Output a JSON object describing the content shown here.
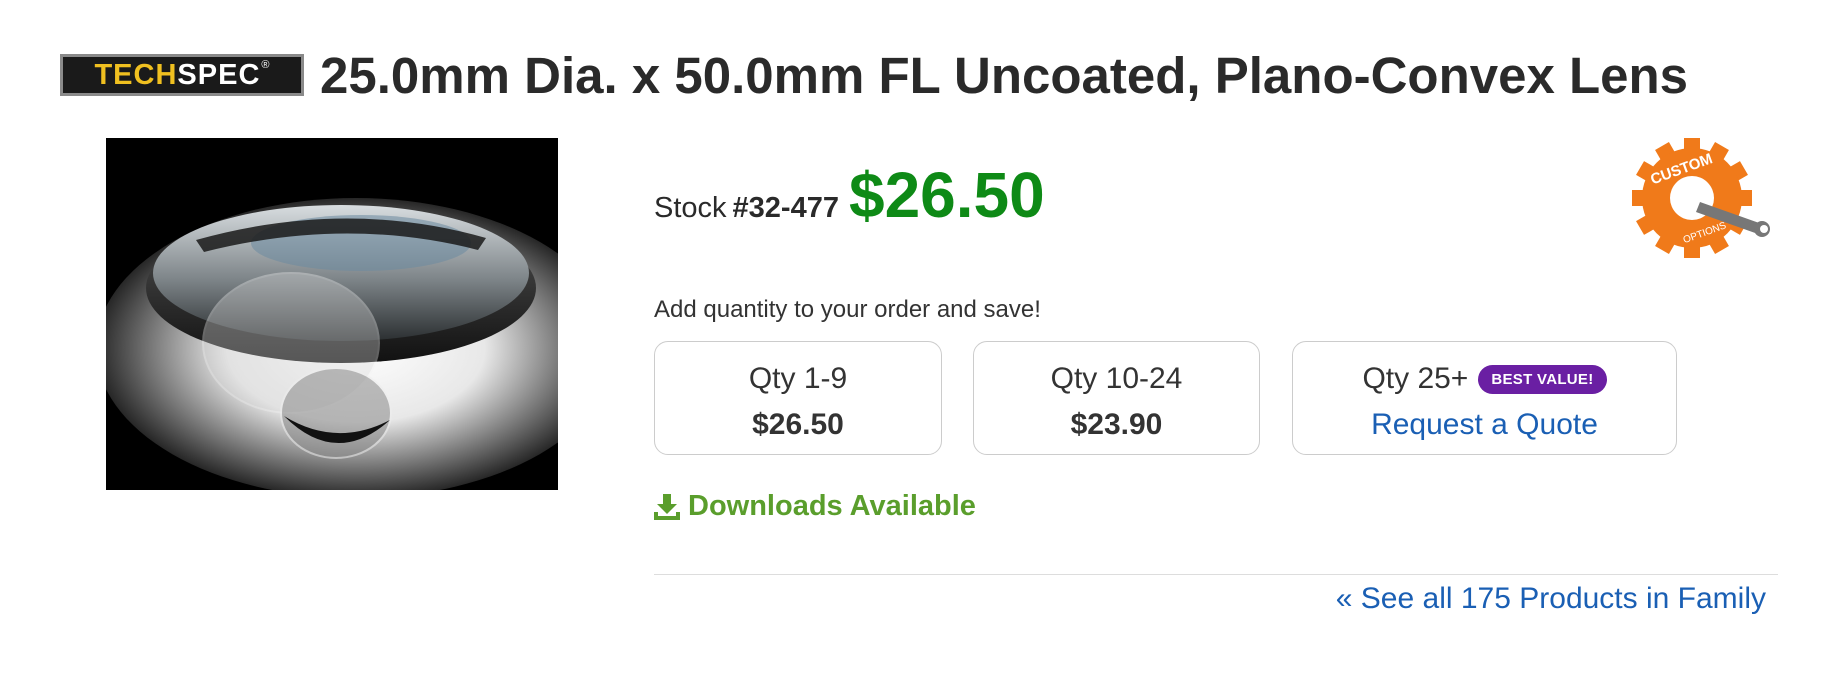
{
  "header": {
    "logo": {
      "word1": "TECH",
      "word2": "SPEC",
      "mark": "®"
    },
    "title": "25.0mm Dia. x 50.0mm FL Uncoated, Plano-Convex Lens"
  },
  "product": {
    "image_icon": "lens-photo",
    "stock_label": "Stock",
    "stock_number": "#32-477",
    "price": "$26.50",
    "price_color": "#0e8a16",
    "custom_badge": {
      "word1": "CUSTOM",
      "word2": "OPTIONS",
      "icon": "wrench-gear-icon",
      "color": "#f07a1a"
    }
  },
  "pricing": {
    "note": "Add quantity to your order and save!",
    "tiers": [
      {
        "label": "Qty 1-9",
        "price": "$26.50"
      },
      {
        "label": "Qty 10-24",
        "price": "$23.90"
      },
      {
        "label": "Qty 25+",
        "badge": "BEST VALUE!",
        "link": "Request a Quote"
      }
    ],
    "badge_color": "#6a1fa3"
  },
  "downloads": {
    "label": "Downloads Available",
    "icon": "download-icon",
    "color": "#5a9e2c"
  },
  "family_link": {
    "label": "« See all 175 Products in Family"
  },
  "colors": {
    "link": "#1a5fb4"
  }
}
